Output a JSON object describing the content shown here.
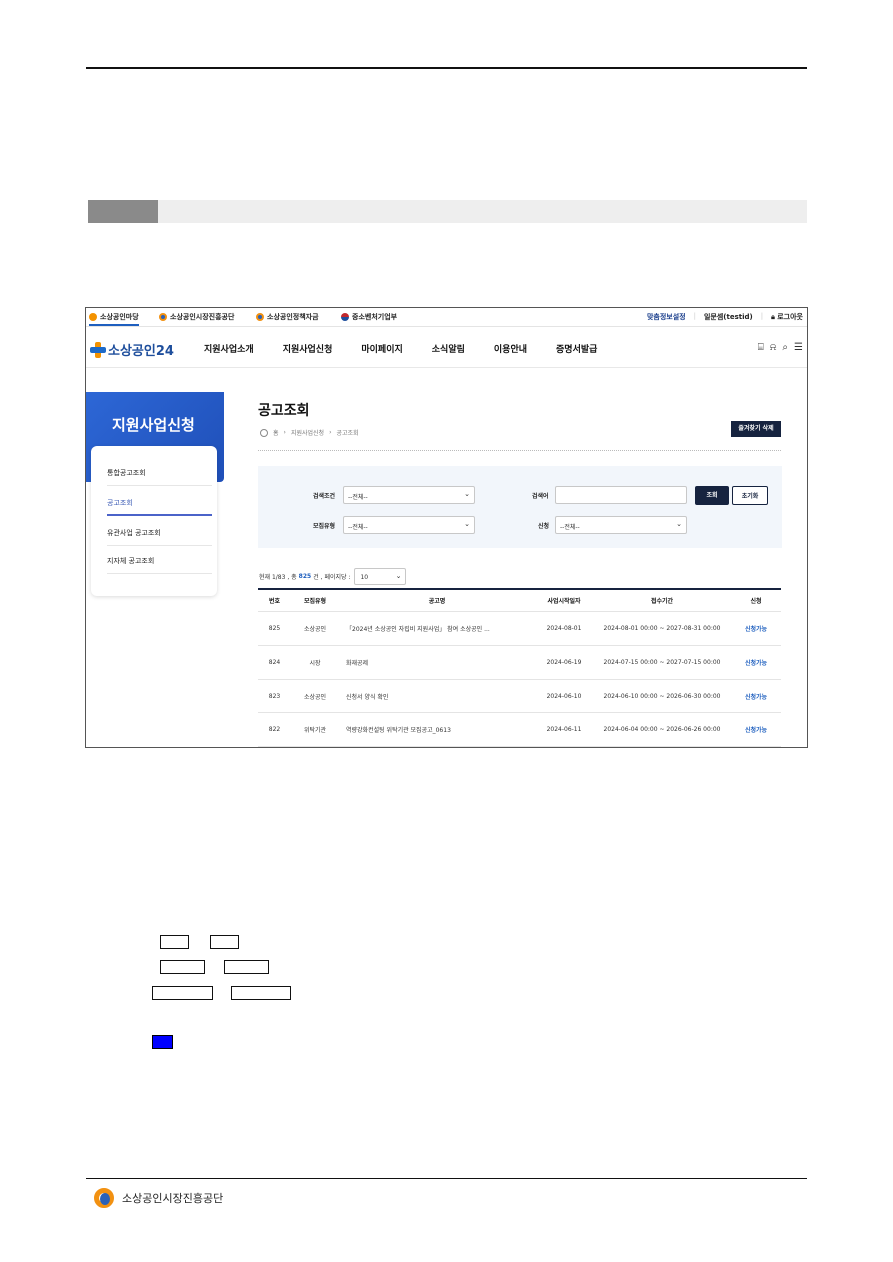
{
  "screenshot": {
    "util_bar": {
      "sites": [
        {
          "label": "소상공인마당",
          "color": "#f39200"
        },
        {
          "label": "소상공인시장진흥공단",
          "color": "#2a61b8"
        },
        {
          "label": "소상공인정책자금",
          "color": "#2a61b8"
        },
        {
          "label": "중소벤처기업부",
          "color": "#c0282d"
        }
      ],
      "custom_info": "맞춤정보설정",
      "user": "일문셈(testid)",
      "logout": "로그아웃"
    },
    "gnb": {
      "logo_text": "소상공인24",
      "menu": [
        "지원사업소개",
        "지원사업신청",
        "마이페이지",
        "소식알림",
        "이용안내",
        "증명서발급"
      ],
      "icons": [
        "store-icon",
        "bell-icon",
        "search-icon",
        "menu-icon"
      ]
    },
    "sidebar": {
      "title": "지원사업신청",
      "items": [
        "통합공고조회",
        "공고조회",
        "유관사업 공고조회",
        "지자체 공고조회"
      ]
    },
    "content": {
      "title": "공고조회",
      "breadcrumb": [
        "홈",
        "지원사업신청",
        "공고조회"
      ],
      "favorite_button": "즐겨찾기 삭제",
      "search": {
        "condition_label": "검색조건",
        "condition_value": "--전체--",
        "keyword_label": "검색어",
        "keyword_value": "",
        "recruit_label": "모집유형",
        "recruit_value": "--전체--",
        "apply_label": "신청",
        "apply_value": "--전체--",
        "search_button": "조회",
        "reset_button": "초기화"
      },
      "summary": {
        "page_text": "현재 1/83 , 총 ",
        "total": "825",
        "total_suffix": "건 , 페이지당 :",
        "per_page": "10"
      },
      "table": {
        "headers": [
          "번호",
          "모집유형",
          "공고명",
          "사업시작일자",
          "접수기간",
          "신청"
        ],
        "rows": [
          {
            "num": "825",
            "type": "소상공인",
            "title": "「2024년 소상공인 자립비 지원사업」 참여 소상공인 ...",
            "date": "2024-08-01",
            "period": "2024-08-01 00:00 ~ 2027-08-31 00:00",
            "status": "신청가능"
          },
          {
            "num": "824",
            "type": "시장",
            "title": "화재공제",
            "date": "2024-06-19",
            "period": "2024-07-15 00:00 ~ 2027-07-15 00:00",
            "status": "신청가능"
          },
          {
            "num": "823",
            "type": "소상공인",
            "title": "신청서 양식 확인",
            "date": "2024-06-10",
            "period": "2024-06-10 00:00 ~ 2026-06-30 00:00",
            "status": "신청가능"
          },
          {
            "num": "822",
            "type": "위탁기관",
            "title": "역량강화컨설팅 위탁기관 모집공고_0613",
            "date": "2024-06-11",
            "period": "2024-06-04 00:00 ~ 2026-06-26 00:00",
            "status": "신청가능"
          }
        ]
      }
    }
  },
  "footer": {
    "org_name": "소상공인시장진흥공단"
  }
}
